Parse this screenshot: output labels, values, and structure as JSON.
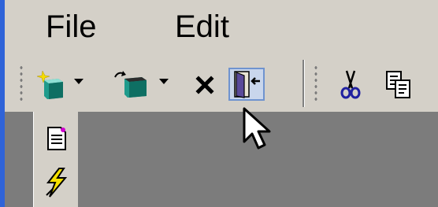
{
  "menu": {
    "items": [
      {
        "label": "File"
      },
      {
        "label": "Edit"
      }
    ]
  },
  "toolbar": {
    "buttons": [
      {
        "icon": "new-document-sparkle-icon",
        "has_dropdown": true
      },
      {
        "icon": "refresh-connection-icon",
        "has_dropdown": true
      },
      {
        "icon": "delete-x-icon"
      },
      {
        "icon": "exit-door-icon",
        "state": "hover"
      },
      {
        "icon": "scissors-icon"
      },
      {
        "icon": "copy-icon"
      }
    ]
  },
  "side_toolbar": {
    "buttons": [
      {
        "icon": "document-icon"
      },
      {
        "icon": "lightning-icon"
      }
    ]
  },
  "colors": {
    "face": "#d4d0c8",
    "workspace": "#7c7c7c",
    "accent_edge": "#2f63d8",
    "hover_fill": "#c9d6ec",
    "hover_border": "#6f93cf"
  }
}
